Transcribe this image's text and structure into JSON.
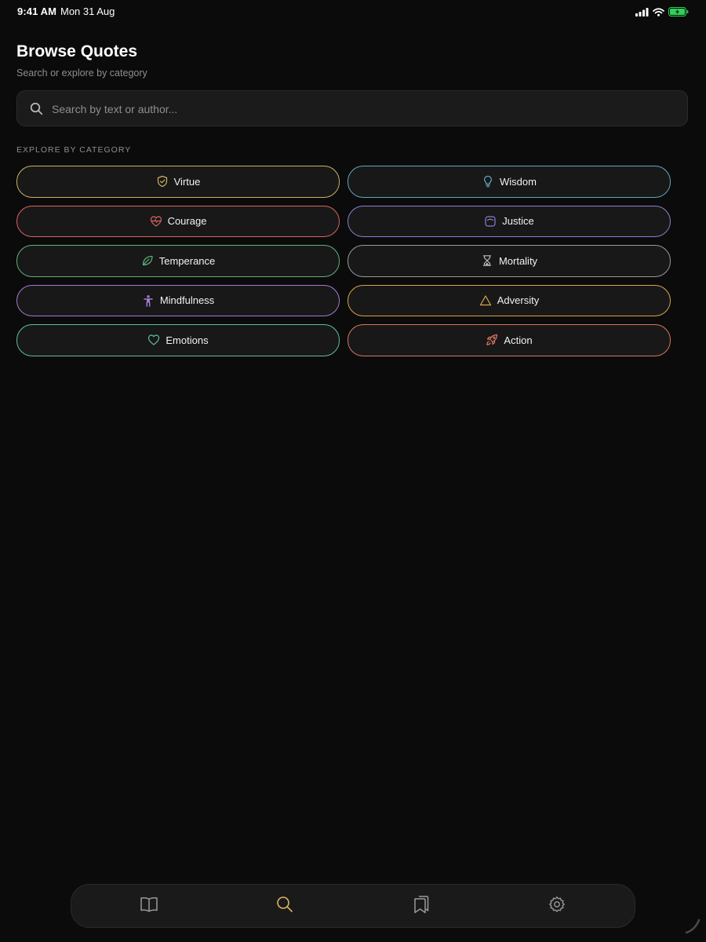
{
  "status_bar": {
    "time": "9:41 AM",
    "date": "Mon 31 Aug",
    "icons": [
      "cellular-signal-icon",
      "wifi-icon",
      "battery-charging-icon"
    ],
    "battery_color": "#30d158"
  },
  "header": {
    "title": "Browse Quotes",
    "subtitle": "Search or explore by category"
  },
  "search": {
    "placeholder": "Search by text or author...",
    "value": ""
  },
  "section_label": "EXPLORE BY CATEGORY",
  "categories": [
    {
      "label": "Virtue",
      "icon": "shield-check-icon",
      "color": "#c9b45f"
    },
    {
      "label": "Wisdom",
      "icon": "lightbulb-icon",
      "color": "#5fa8bd"
    },
    {
      "label": "Courage",
      "icon": "heart-pulse-icon",
      "color": "#d9645f"
    },
    {
      "label": "Justice",
      "icon": "scale-icon",
      "color": "#8a7fd1"
    },
    {
      "label": "Temperance",
      "icon": "leaf-icon",
      "color": "#5fb27a"
    },
    {
      "label": "Mortality",
      "icon": "hourglass-icon",
      "color": "#9a9a9a"
    },
    {
      "label": "Mindfulness",
      "icon": "person-meditate-icon",
      "color": "#a57ad0"
    },
    {
      "label": "Adversity",
      "icon": "warning-triangle-icon",
      "color": "#d9a449"
    },
    {
      "label": "Emotions",
      "icon": "heart-icon",
      "color": "#5fbf9a"
    },
    {
      "label": "Action",
      "icon": "rocket-icon",
      "color": "#d9765f"
    }
  ],
  "tab_bar": {
    "items": [
      {
        "name": "read",
        "icon": "book-open-icon",
        "active": false
      },
      {
        "name": "search",
        "icon": "search-icon",
        "active": true
      },
      {
        "name": "bookmarks",
        "icon": "bookmarks-icon",
        "active": false
      },
      {
        "name": "settings",
        "icon": "gear-icon",
        "active": false
      }
    ],
    "active_color": "#d9b45f",
    "inactive_color": "#9a9a9a"
  }
}
